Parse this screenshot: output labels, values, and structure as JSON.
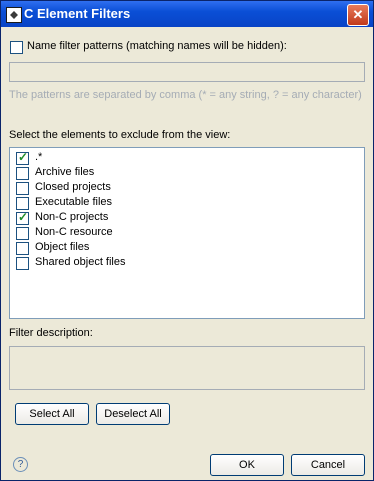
{
  "window": {
    "title": "C Element Filters",
    "close": "✕"
  },
  "filter": {
    "checkbox_label": "Name filter patterns (matching names will be hidden):",
    "pattern_value": "",
    "hint": "The patterns are separated by comma (* = any string, ? = any character)"
  },
  "elements": {
    "heading": "Select the elements to exclude from the view:",
    "items": [
      {
        "label": ".*",
        "checked": true
      },
      {
        "label": "Archive files",
        "checked": false
      },
      {
        "label": "Closed projects",
        "checked": false
      },
      {
        "label": "Executable files",
        "checked": false
      },
      {
        "label": "Non-C projects",
        "checked": true
      },
      {
        "label": "Non-C resource",
        "checked": false
      },
      {
        "label": "Object files",
        "checked": false
      },
      {
        "label": "Shared object files",
        "checked": false
      }
    ]
  },
  "description": {
    "heading": "Filter description:",
    "value": ""
  },
  "buttons": {
    "select_all": "Select All",
    "deselect_all": "Deselect All",
    "ok": "OK",
    "cancel": "Cancel",
    "help": "?"
  }
}
